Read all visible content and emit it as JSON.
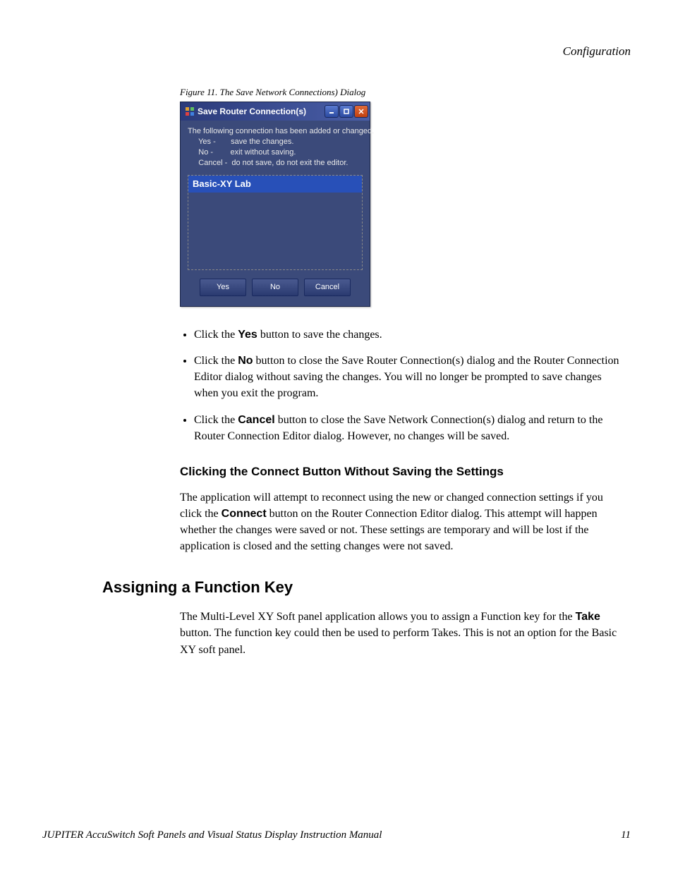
{
  "header": {
    "section": "Configuration"
  },
  "figure": {
    "caption": "Figure 11.  The Save Network Connections) Dialog"
  },
  "dialog": {
    "title": "Save Router Connection(s)",
    "message_l1": "The following connection has been added or changed.",
    "message_l2": "     Yes -       save the changes.",
    "message_l3": "     No -        exit without saving.",
    "message_l4": "     Cancel -  do not save, do not exit the editor.",
    "list_item": "Basic-XY Lab",
    "btn_yes": "Yes",
    "btn_no": "No",
    "btn_cancel": "Cancel"
  },
  "bullets": {
    "b1_pre": "Click the ",
    "b1_bold": "Yes",
    "b1_post": " button to save the changes.",
    "b2_pre": "Click the ",
    "b2_bold": "No",
    "b2_post": " button to close the Save Router Connection(s) dialog and the Router Connection Editor dialog without saving the changes. You will no longer be prompted to save changes when you exit the program.",
    "b3_pre": "Click the ",
    "b3_bold": "Cancel",
    "b3_post": " button to close the Save Network Connection(s) dialog and return to the Router Connection Editor dialog. However, no changes will be saved."
  },
  "sub1": {
    "heading": "Clicking the Connect Button Without Saving the Settings",
    "p_pre": "The application will attempt to reconnect using the new or changed connection settings if you click the ",
    "p_bold": "Connect",
    "p_post": " button on the Router Connection Editor dialog. This attempt will happen whether the changes were saved or not. These settings are temporary and will be lost if the application is closed and the setting changes were not saved."
  },
  "section2": {
    "heading": "Assigning a Function Key",
    "p_pre": "The Multi-Level XY Soft panel application allows you to assign a Function key for the ",
    "p_bold": "Take",
    "p_post": " button. The function key could then be used to perform Takes. This is not an option for the Basic XY soft panel."
  },
  "footer": {
    "left": "JUPITER AccuSwitch Soft Panels and Visual Status Display Instruction Manual",
    "right": "11"
  }
}
